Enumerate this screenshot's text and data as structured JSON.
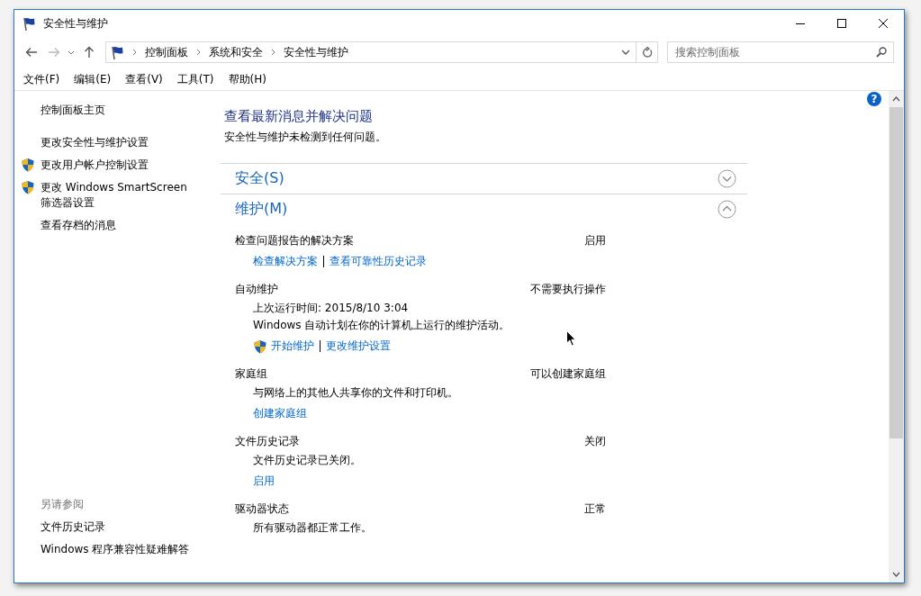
{
  "window": {
    "title": "安全性与维护"
  },
  "address_bar": {
    "path": [
      "控制面板",
      "系统和安全",
      "安全性与维护"
    ]
  },
  "search": {
    "placeholder": "搜索控制面板"
  },
  "help": "?",
  "menu": [
    "文件(F)",
    "编辑(E)",
    "查看(V)",
    "工具(T)",
    "帮助(H)"
  ],
  "sidebar": {
    "home": "控制面板主页",
    "items": [
      {
        "label": "更改安全性与维护设置",
        "shield": false
      },
      {
        "label": "更改用户帐户控制设置",
        "shield": true
      },
      {
        "label": "更改 Windows SmartScreen 筛选器设置",
        "shield": true
      },
      {
        "label": "查看存档的消息",
        "shield": false
      }
    ],
    "see_also": {
      "title": "另请参阅",
      "items": [
        "文件历史记录",
        "Windows 程序兼容性疑难解答"
      ]
    }
  },
  "main": {
    "heading": "查看最新消息并解决问题",
    "summary": "安全性与维护未检测到任何问题。",
    "sections": [
      {
        "title": "安全(S)",
        "expanded": false
      },
      {
        "title": "维护(M)",
        "expanded": true,
        "items": [
          {
            "name": "检查问题报告的解决方案",
            "status": "启用",
            "links": [
              {
                "label": "检查解决方案",
                "shield": false
              },
              {
                "label": "查看可靠性历史记录",
                "shield": false
              }
            ]
          },
          {
            "name": "自动维护",
            "status": "不需要执行操作",
            "lines": [
              "上次运行时间: 2015/8/10 3:04",
              "Windows 自动计划在你的计算机上运行的维护活动。"
            ],
            "links": [
              {
                "label": "开始维护",
                "shield": true
              },
              {
                "label": "更改维护设置",
                "shield": false
              }
            ]
          },
          {
            "name": "家庭组",
            "status": "可以创建家庭组",
            "lines": [
              "与网络上的其他人共享你的文件和打印机。"
            ],
            "links": [
              {
                "label": "创建家庭组",
                "shield": false
              }
            ]
          },
          {
            "name": "文件历史记录",
            "status": "关闭",
            "lines": [
              "文件历史记录已关闭。"
            ],
            "links": [
              {
                "label": "启用",
                "shield": false
              }
            ]
          },
          {
            "name": "驱动器状态",
            "status": "正常",
            "lines": [
              "所有驱动器都正常工作。"
            ]
          }
        ]
      }
    ]
  }
}
